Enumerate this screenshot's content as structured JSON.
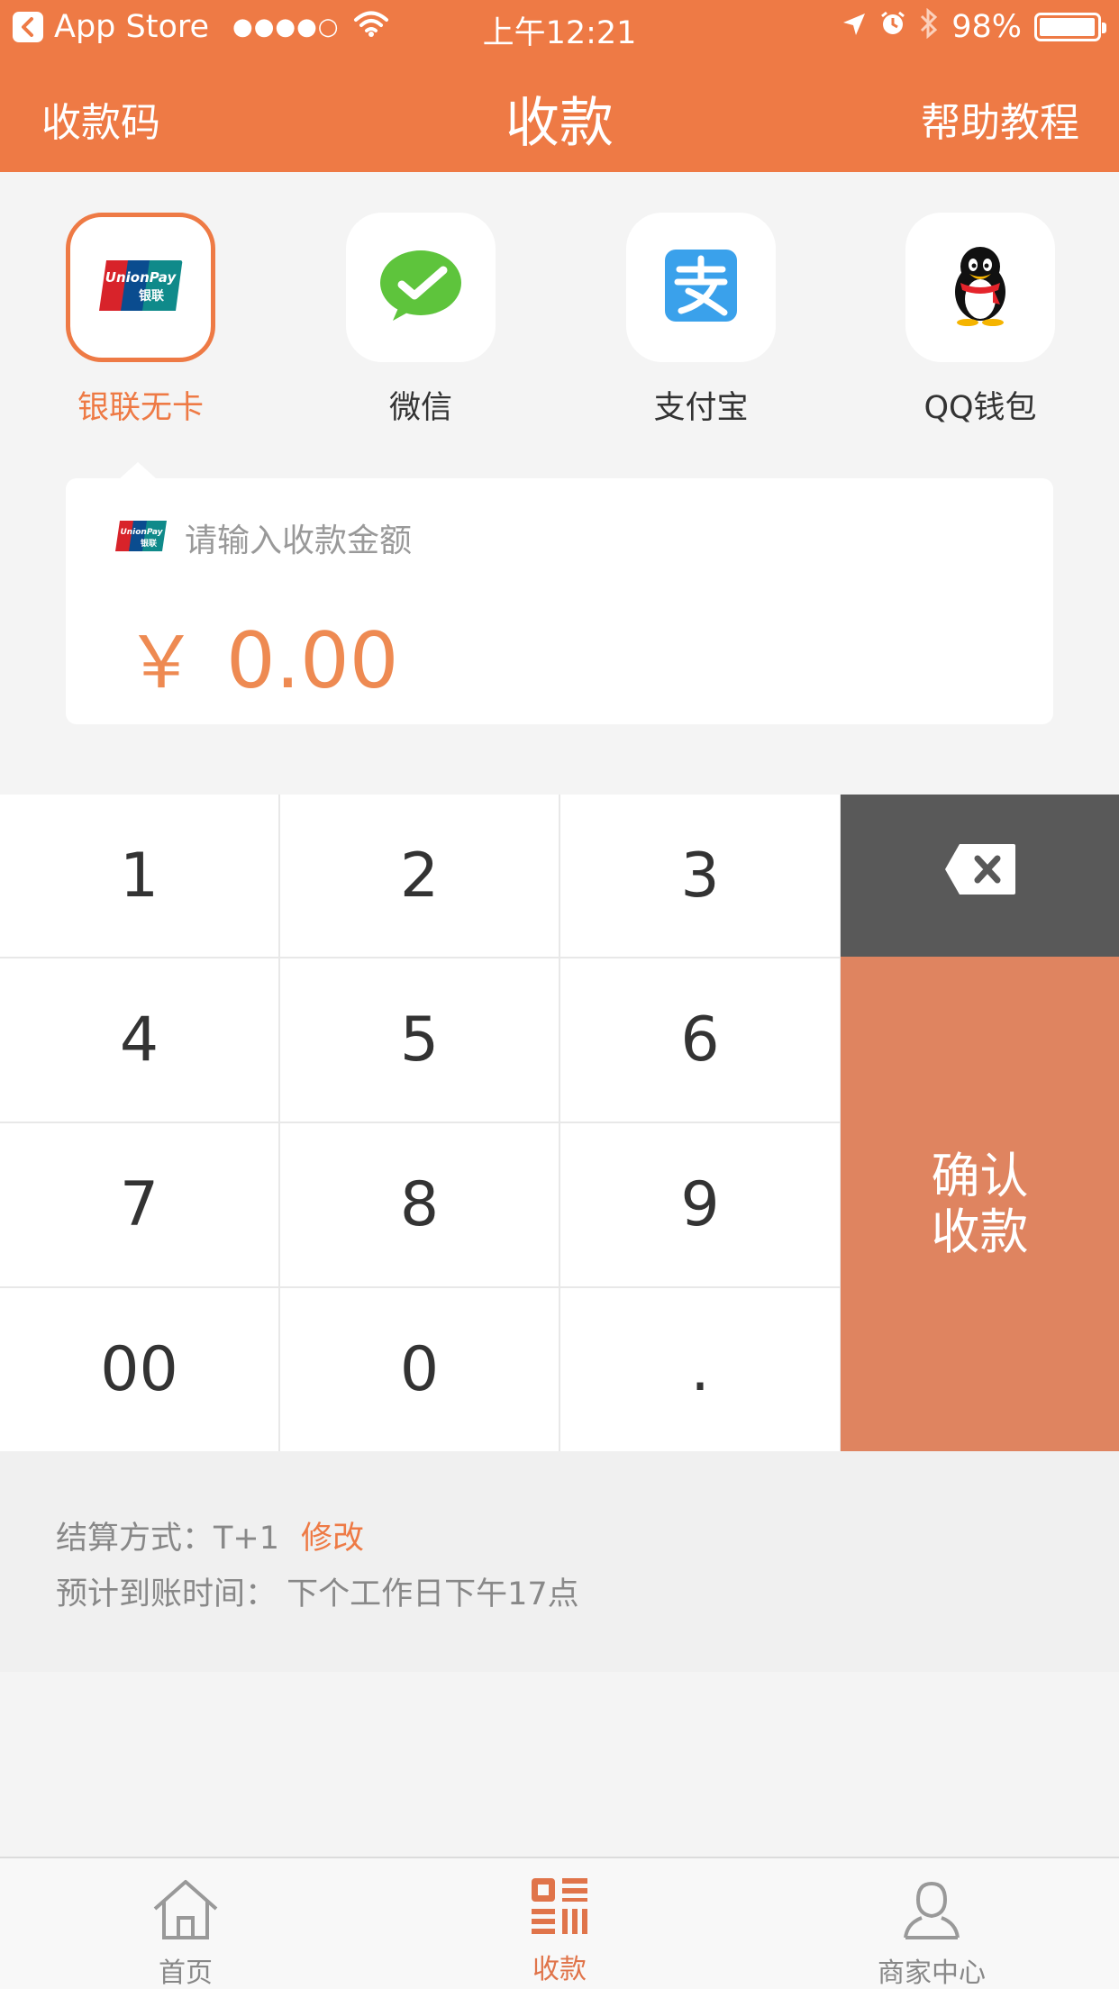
{
  "status_bar": {
    "back_app": "App Store",
    "signal": "●●●●○",
    "time": "上午12:21",
    "battery": "98%",
    "battery_level": 0.98
  },
  "nav": {
    "left": "收款码",
    "title": "收款",
    "right": "帮助教程"
  },
  "methods": [
    {
      "label": "银联无卡",
      "icon": "unionpay-icon",
      "selected": true
    },
    {
      "label": "微信",
      "icon": "wechat-icon",
      "selected": false
    },
    {
      "label": "支付宝",
      "icon": "alipay-icon",
      "selected": false
    },
    {
      "label": "QQ钱包",
      "icon": "qq-wallet-icon",
      "selected": false
    }
  ],
  "amount": {
    "placeholder": "请输入收款金额",
    "currency": "￥",
    "value": "0.00"
  },
  "keypad": {
    "keys": [
      "1",
      "2",
      "3",
      "4",
      "5",
      "6",
      "7",
      "8",
      "9",
      "00",
      "0",
      "."
    ],
    "confirm_line1": "确认",
    "confirm_line2": "收款",
    "delete_icon": "backspace-icon"
  },
  "settlement": {
    "method_label": "结算方式：T+1",
    "edit_label": "修改",
    "eta_label": "预计到账时间：  下个工作日下午17点"
  },
  "tabbar": {
    "tabs": [
      {
        "label": "首页",
        "icon": "home-icon",
        "active": false
      },
      {
        "label": "收款",
        "icon": "qr-receive-icon",
        "active": true
      },
      {
        "label": "商家中心",
        "icon": "user-icon",
        "active": false
      }
    ]
  },
  "colors": {
    "brand": "#ee7a45",
    "confirm": "#df8460",
    "delete_key": "#595959"
  }
}
